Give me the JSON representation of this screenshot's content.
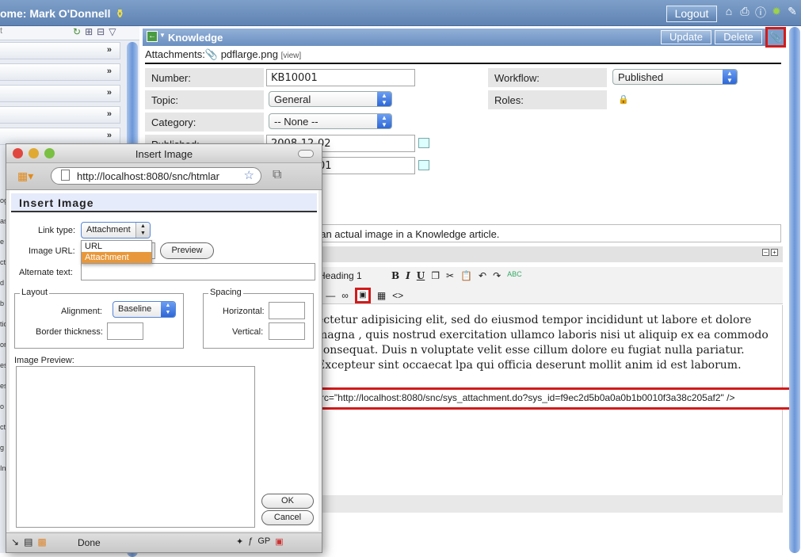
{
  "header": {
    "welcome": "ome: Mark O'Donnell",
    "logout_label": "Logout",
    "icons": [
      "home-icon",
      "print-icon",
      "help-icon",
      "bug-icon",
      "edit-icon"
    ]
  },
  "leftnav": {
    "filter_placeholder": "t",
    "side_letters": [
      "og",
      "as",
      "e",
      "ct",
      "d",
      "b",
      "tic",
      "or",
      "es",
      "es",
      "o",
      "ct",
      "g",
      "In"
    ]
  },
  "form": {
    "title": "Knowledge",
    "update_label": "Update",
    "delete_label": "Delete",
    "attachments_label": "Attachments:",
    "attachment_file": "pdflarge.png",
    "attachment_view": "[view]",
    "fields": {
      "number_label": "Number:",
      "number_value": "KB10001",
      "topic_label": "Topic:",
      "topic_value": "General",
      "category_label": "Category:",
      "category_value": "-- None --",
      "published_label": "Published:",
      "published_value": "2008-12-02",
      "valid_value": "01",
      "workflow_label": "Workflow:",
      "workflow_value": "Published",
      "roles_label": "Roles:"
    },
    "short_description": "t an actual image in a Knowledge article.",
    "editor": {
      "heading_value": "Heading 1",
      "bold": "B",
      "italic": "I",
      "underline": "U",
      "body": "ectetur adipisicing elit, sed do eiusmod tempor incididunt ut labore et dolore magna , quis nostrud exercitation ullamco laboris nisi ut aliquip ex ea commodo consequat. Duis n voluptate velit esse cillum dolore eu fugiat nulla pariatur. Excepteur sint occaecat lpa qui officia deserunt mollit anim id est laborum.",
      "img_tag": "<img align=\"left\" src=\"http://localhost:8080/snc/sys_attachment.do?sys_id=f9ec2d5b0a0a0b1b0010f3a38c205af2\" />"
    }
  },
  "popup": {
    "window_title": "Insert Image",
    "url": "http://localhost:8080/snc/htmlar",
    "heading": "Insert Image",
    "link_type_label": "Link type:",
    "link_type_value": "Attachment",
    "link_type_options": [
      "URL",
      "Attachment"
    ],
    "image_url_label": "Image URL:",
    "preview_label": "Preview",
    "alt_text_label": "Alternate text:",
    "layout_legend": "Layout",
    "alignment_label": "Alignment:",
    "alignment_value": "Baseline",
    "border_label": "Border thickness:",
    "spacing_legend": "Spacing",
    "horizontal_label": "Horizontal:",
    "vertical_label": "Vertical:",
    "image_preview_label": "Image Preview:",
    "ok_label": "OK",
    "cancel_label": "Cancel",
    "status": "Done"
  }
}
